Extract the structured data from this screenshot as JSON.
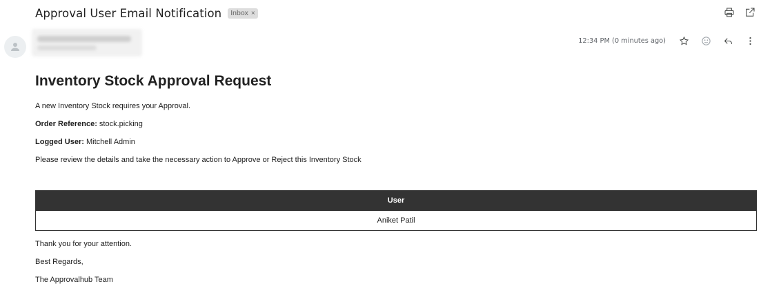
{
  "email": {
    "subject": "Approval User Email Notification",
    "label": "Inbox",
    "label_remove": "×",
    "timestamp": "12:34 PM (0 minutes ago)"
  },
  "icons": {
    "print": "printer-icon",
    "popout": "open-in-new-window-icon",
    "avatar": "person-icon",
    "star": "star-icon",
    "emoji": "emoji-reaction-icon",
    "reply": "reply-icon",
    "more": "more-vert-icon"
  },
  "body": {
    "heading": "Inventory Stock Approval Request",
    "intro": "A new Inventory Stock requires your Approval.",
    "order_ref_label": "Order Reference:",
    "order_ref_value": " stock.picking",
    "logged_user_label": "Logged User:",
    "logged_user_value": " Mitchell Admin",
    "instruction": "Please review the details and take the necessary action to Approve or Reject this Inventory Stock",
    "table": {
      "header": "User",
      "rows": [
        "Aniket Patil"
      ]
    },
    "thanks": "Thank you for your attention.",
    "regards": "Best Regards,",
    "signature": "The Approvalhub Team"
  },
  "colors": {
    "table_header_bg": "#333333",
    "table_header_text": "#ffffff",
    "label_chip_bg": "#dddddd"
  }
}
